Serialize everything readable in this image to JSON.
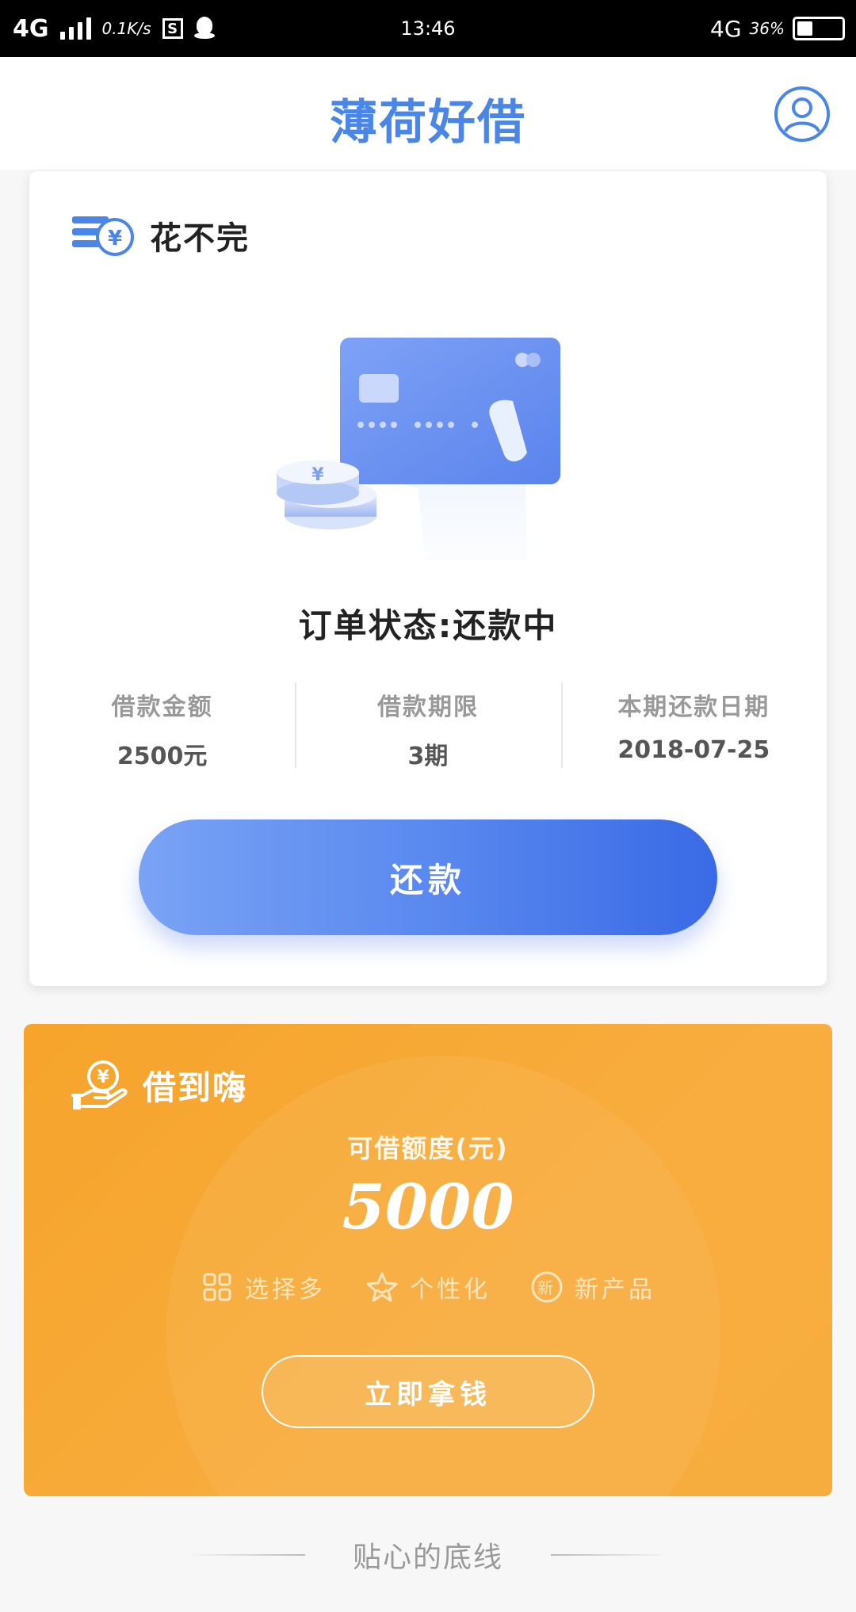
{
  "status_bar": {
    "network": "4G",
    "speed": "0.1K/s",
    "time": "13:46",
    "network_right": "4G",
    "battery": "36%"
  },
  "header": {
    "title": "薄荷好借"
  },
  "loan_card": {
    "title": "花不完",
    "status": "订单状态:还款中",
    "stats": [
      {
        "label": "借款金额",
        "value": "2500元"
      },
      {
        "label": "借款期限",
        "value": "3期"
      },
      {
        "label": "本期还款日期",
        "value": "2018-07-25"
      }
    ],
    "repay_button": "还款",
    "accent_color": "#4a86e8"
  },
  "promo_card": {
    "title": "借到嗨",
    "limit_label": "可借额度(元)",
    "limit_value": "5000",
    "features": [
      "选择多",
      "个性化",
      "新产品"
    ],
    "feature_icons": [
      "grid-icon",
      "star-icon",
      "new-badge-icon"
    ],
    "new_badge_text": "新",
    "cta_button": "立即拿钱",
    "background_color": "#f7a935"
  },
  "footer": {
    "text": "贴心的底线"
  }
}
